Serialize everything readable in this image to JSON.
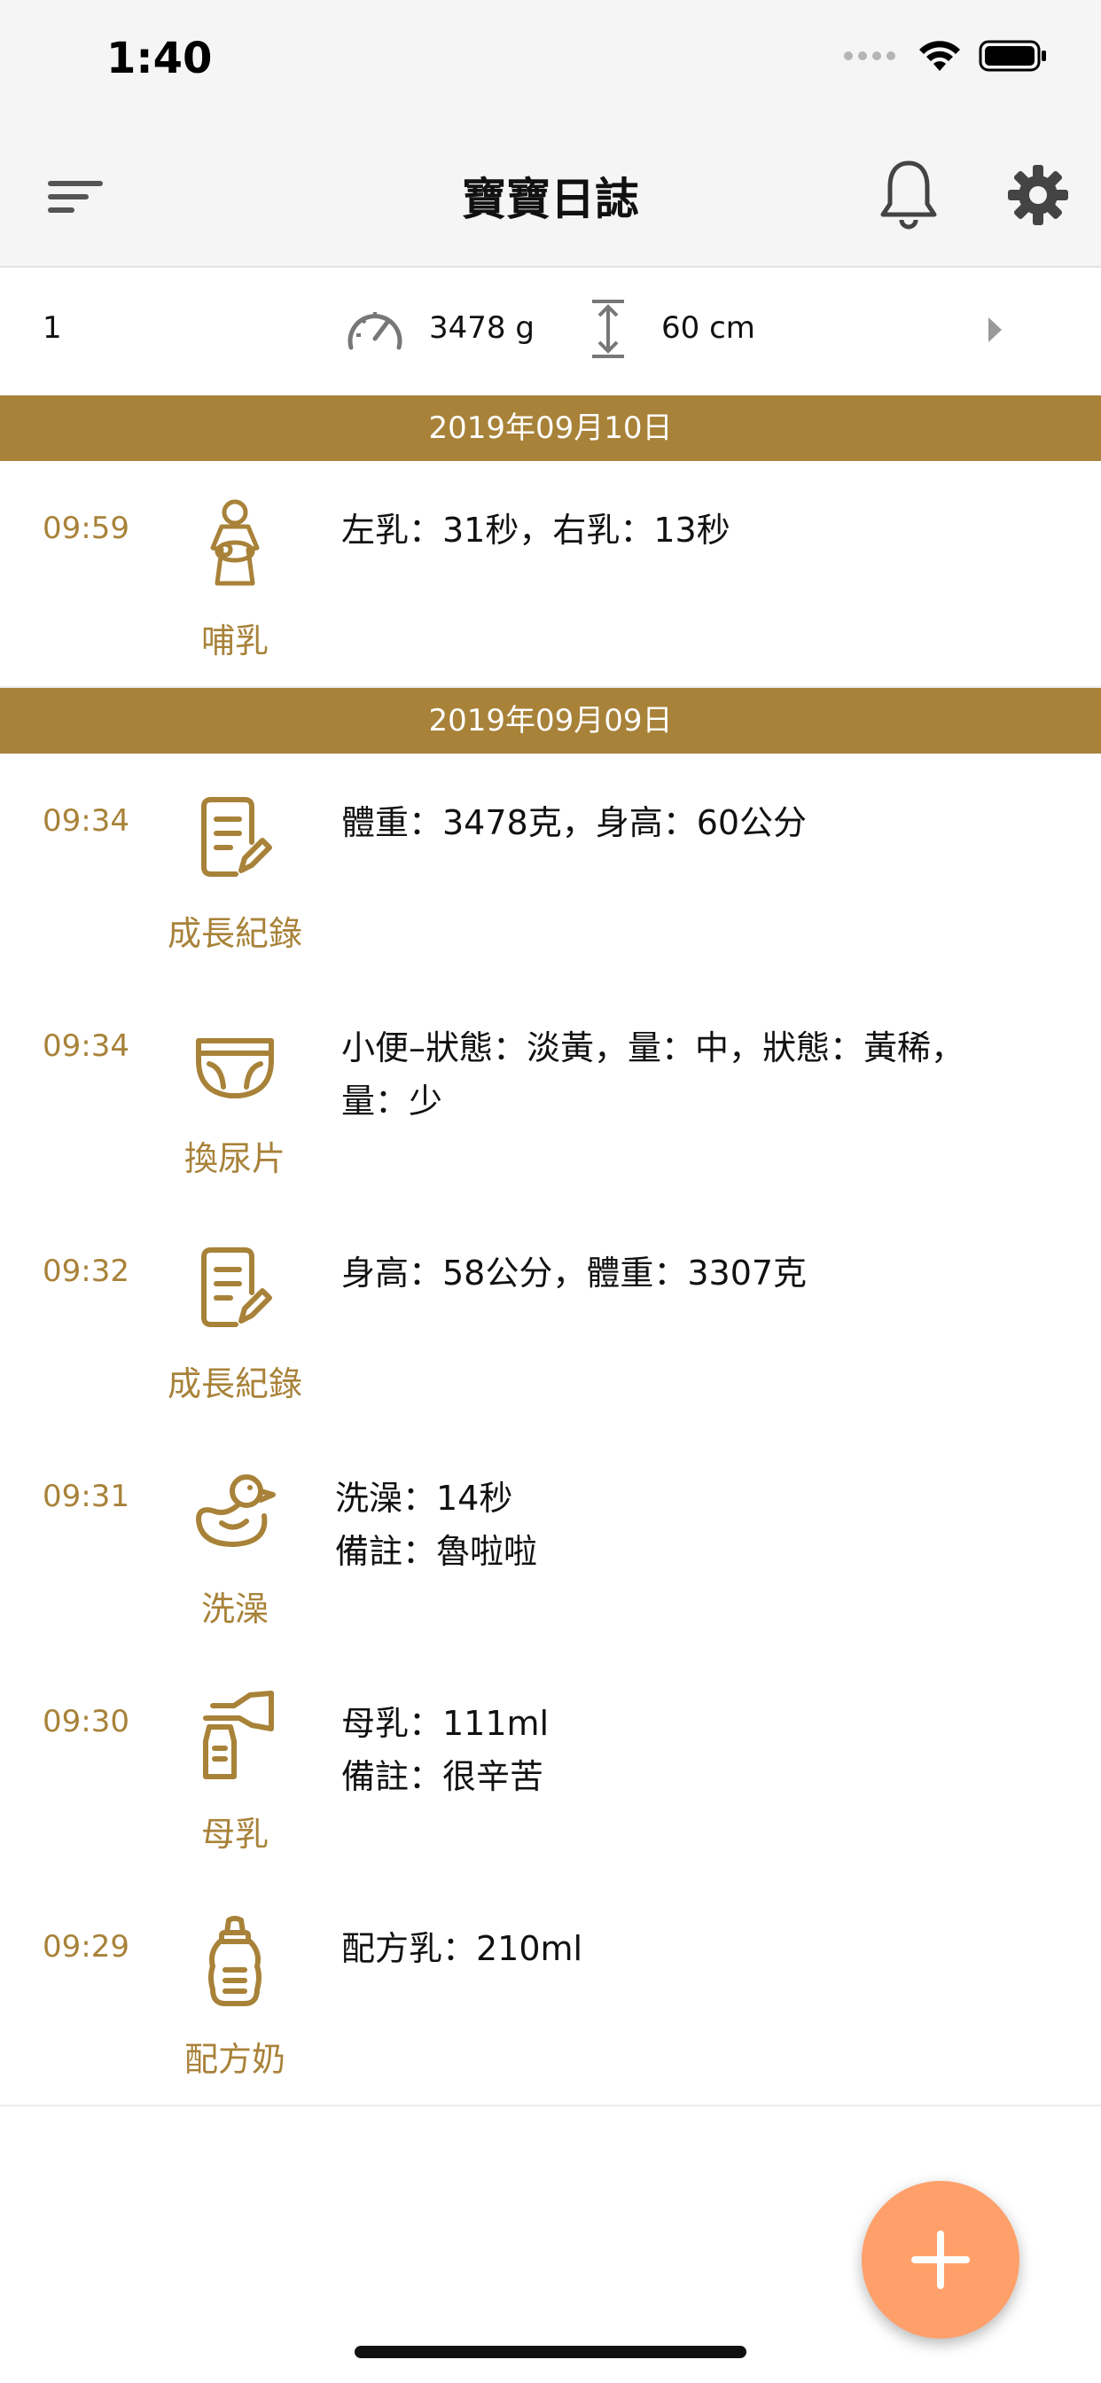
{
  "status_bar": {
    "time": "1:40"
  },
  "nav": {
    "title": "寶寶日誌"
  },
  "baby": {
    "name": "1",
    "weight": "3478 g",
    "height": "60 cm"
  },
  "colors": {
    "accent": "#a88239",
    "fab": "#ffa06b",
    "nav_bg": "#f5f5f5"
  },
  "groups": [
    {
      "date": "2019年09月10日",
      "entries": [
        {
          "time": "09:59",
          "icon": "breastfeeding-icon",
          "label": "哺乳",
          "lines": [
            "左乳：31秒，右乳：13秒"
          ]
        }
      ]
    },
    {
      "date": "2019年09月09日",
      "entries": [
        {
          "time": "09:34",
          "icon": "growth-record-icon",
          "label": "成長紀錄",
          "lines": [
            "體重：3478克，身高：60公分"
          ]
        },
        {
          "time": "09:34",
          "icon": "diaper-icon",
          "label": "換尿片",
          "lines": [
            "小便–狀態：淡黃，量：中，狀態：黃稀，",
            "量：少"
          ]
        },
        {
          "time": "09:32",
          "icon": "growth-record-icon",
          "label": "成長紀錄",
          "lines": [
            "身高：58公分，體重：3307克"
          ]
        },
        {
          "time": "09:31",
          "icon": "duck-bath-icon",
          "label": "洗澡",
          "lines": [
            "洗澡：14秒",
            "備註：魯啦啦"
          ]
        },
        {
          "time": "09:30",
          "icon": "breast-pump-icon",
          "label": "母乳",
          "lines": [
            "母乳：111ml",
            "備註：很辛苦"
          ]
        },
        {
          "time": "09:29",
          "icon": "baby-bottle-icon",
          "label": "配方奶",
          "lines": [
            "配方乳：210ml"
          ]
        }
      ]
    }
  ]
}
